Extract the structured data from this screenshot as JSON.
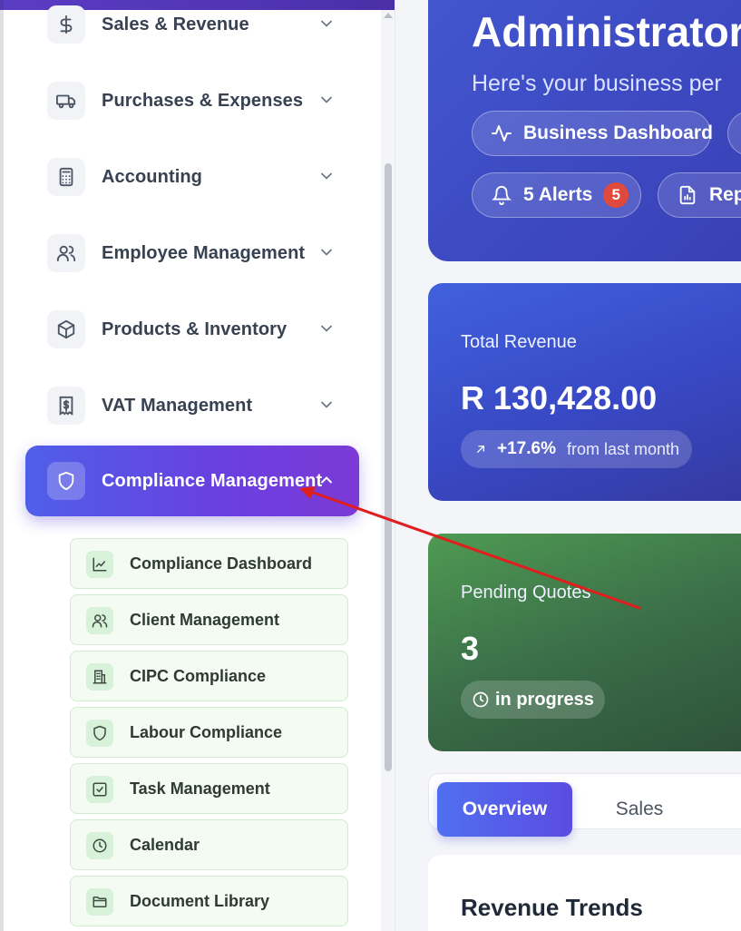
{
  "sidebar": {
    "items": [
      {
        "label": "Sales & Revenue",
        "icon": "dollar-icon"
      },
      {
        "label": "Purchases & Expenses",
        "icon": "truck-icon"
      },
      {
        "label": "Accounting",
        "icon": "calculator-icon"
      },
      {
        "label": "Employee Management",
        "icon": "users-icon"
      },
      {
        "label": "Products & Inventory",
        "icon": "box-icon"
      },
      {
        "label": "VAT Management",
        "icon": "receipt-icon"
      },
      {
        "label": "Compliance Management",
        "icon": "shield-icon",
        "active": true,
        "expanded": true
      }
    ],
    "subitems": [
      {
        "label": "Compliance Dashboard",
        "icon": "chart-line-icon"
      },
      {
        "label": "Client Management",
        "icon": "users-icon"
      },
      {
        "label": "CIPC Compliance",
        "icon": "building-icon"
      },
      {
        "label": "Labour Compliance",
        "icon": "shield-icon"
      },
      {
        "label": "Task Management",
        "icon": "check-square-icon"
      },
      {
        "label": "Calendar",
        "icon": "clock-icon"
      },
      {
        "label": "Document Library",
        "icon": "folder-icon"
      }
    ]
  },
  "hero": {
    "title": "Administrator!",
    "subtitle": "Here's your business per",
    "buttons": {
      "dashboard": "Business Dashboard",
      "alerts": "5 Alerts",
      "alerts_count": "5",
      "reports": "Rep"
    }
  },
  "cards": {
    "revenue": {
      "label": "Total Revenue",
      "value": "R 130,428.00",
      "change": "+17.6%",
      "change_note": "from last month"
    },
    "quotes": {
      "label": "Pending Quotes",
      "value": "3",
      "status": "in progress"
    }
  },
  "tabs": {
    "active": "Overview",
    "next": "Sales"
  },
  "section": {
    "title": "Revenue Trends"
  },
  "colors": {
    "accent": "#5b4ce0",
    "alert": "#e14a3b",
    "annotation": "#e01e1e"
  }
}
